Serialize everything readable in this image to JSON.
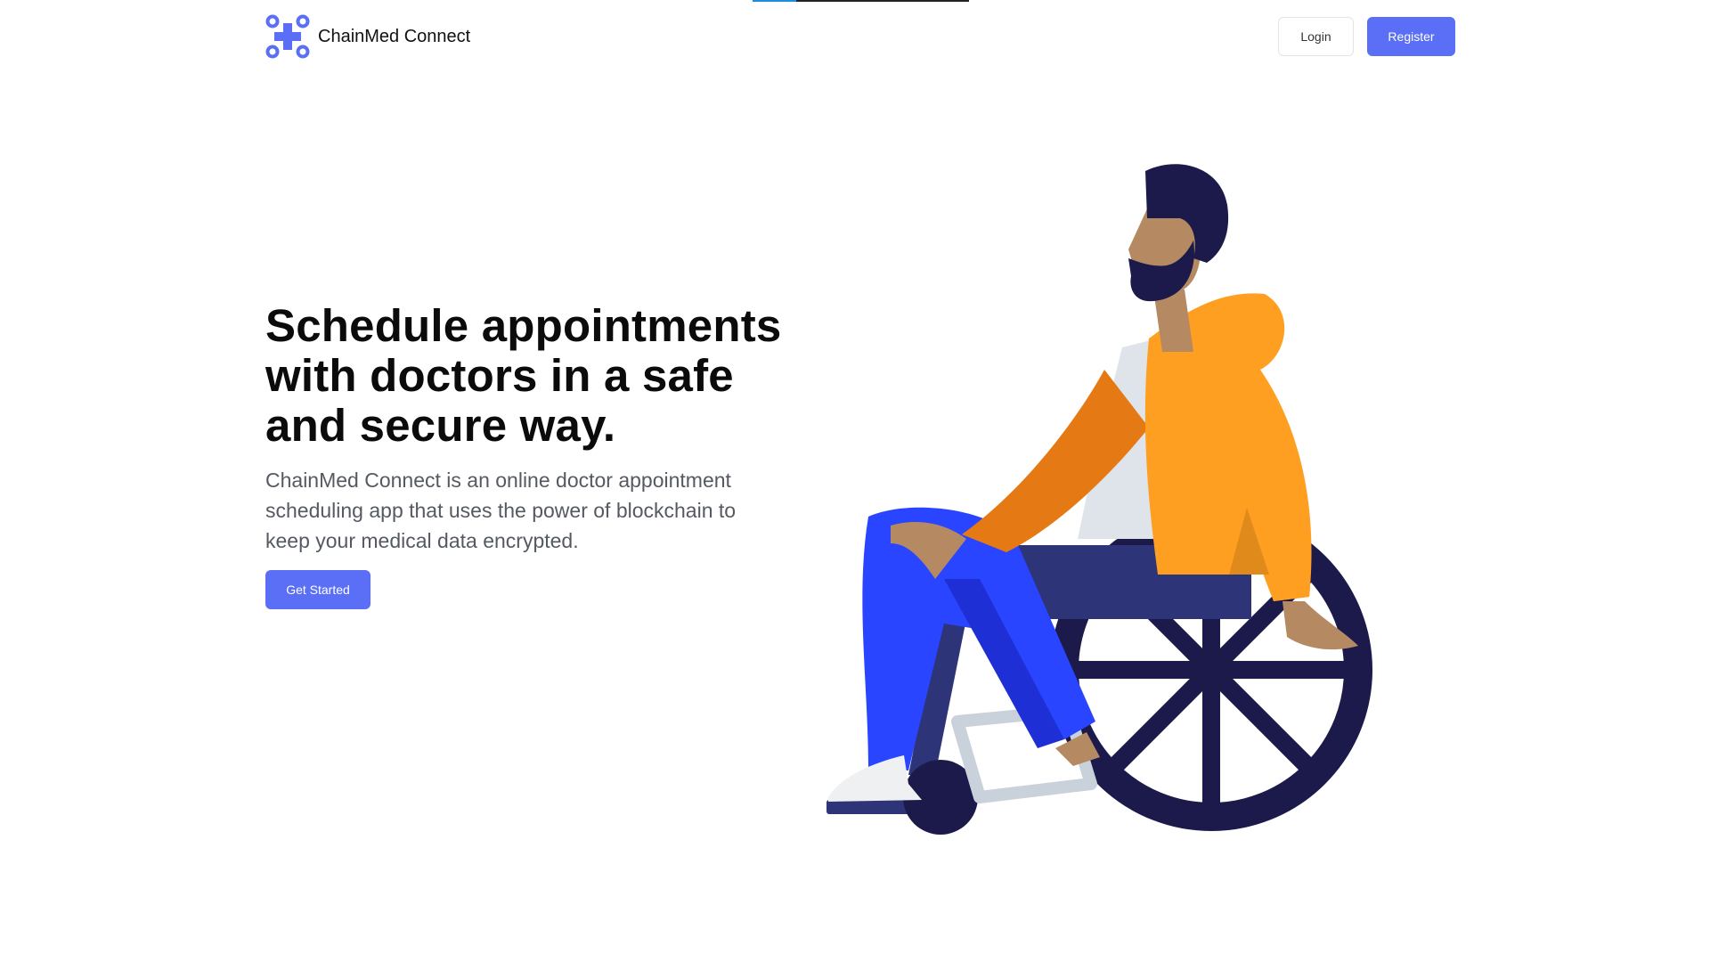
{
  "header": {
    "brand_name": "ChainMed Connect",
    "login_label": "Login",
    "register_label": "Register"
  },
  "hero": {
    "title": "Schedule appointments with doctors in a safe and secure way.",
    "subtitle": "ChainMed Connect is an online doctor appointment scheduling app that uses the power of blockchain to keep your medical data encrypted.",
    "cta_label": "Get Started"
  },
  "page_progress": 0.2,
  "colors": {
    "accent": "#5a6ff5",
    "orange": "#ff9f22",
    "dark_navy": "#1b1a4a",
    "blue_pants": "#2a45ff"
  },
  "icons": {
    "logo": "medical-cross-nodes-icon"
  }
}
